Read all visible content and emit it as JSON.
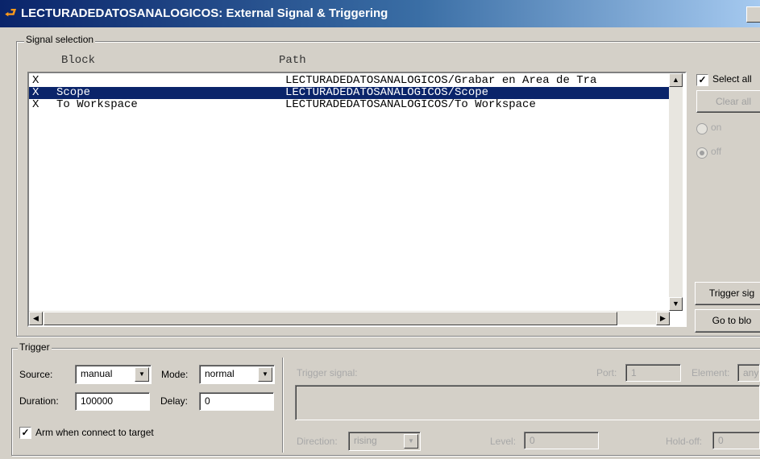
{
  "window": {
    "title": "LECTURADEDATOSANALOGICOS: External Signal & Triggering"
  },
  "signal_selection": {
    "group_label": "Signal selection",
    "columns": {
      "block": "Block",
      "path": "Path"
    },
    "rows": [
      {
        "mark": "X",
        "block": "",
        "path": "LECTURADEDATOSANALOGICOS/Grabar en Area de Tra",
        "selected": false
      },
      {
        "mark": "X",
        "block": "Scope",
        "path": "LECTURADEDATOSANALOGICOS/Scope",
        "selected": true
      },
      {
        "mark": "X",
        "block": "To Workspace",
        "path": "LECTURADEDATOSANALOGICOS/To Workspace",
        "selected": false
      }
    ],
    "select_all_label": "Select all",
    "select_all_checked": true,
    "clear_all_label": "Clear all",
    "on_label": "on",
    "off_label": "off",
    "trigger_signal_label": "Trigger sig",
    "go_to_block_label": "Go to blo"
  },
  "trigger": {
    "group_label": "Trigger",
    "source_label": "Source:",
    "source_value": "manual",
    "mode_label": "Mode:",
    "mode_value": "normal",
    "duration_label": "Duration:",
    "duration_value": "100000",
    "delay_label": "Delay:",
    "delay_value": "0",
    "arm_label": "Arm when connect to target",
    "arm_checked": true,
    "trigger_signal_label": "Trigger signal:",
    "port_label": "Port:",
    "port_value": "1",
    "element_label": "Element:",
    "element_value": "any",
    "direction_label": "Direction:",
    "direction_value": "rising",
    "level_label": "Level:",
    "level_value": "0",
    "holdoff_label": "Hold-off:",
    "holdoff_value": "0"
  },
  "colors": {
    "selection": "#0a246a",
    "window_bg": "#d4d0c8",
    "title_gradient_start": "#0a246a"
  },
  "icons": {
    "title": "simulink-icon",
    "checkmark": "check-icon",
    "dropdown": "chevron-down-icon"
  }
}
